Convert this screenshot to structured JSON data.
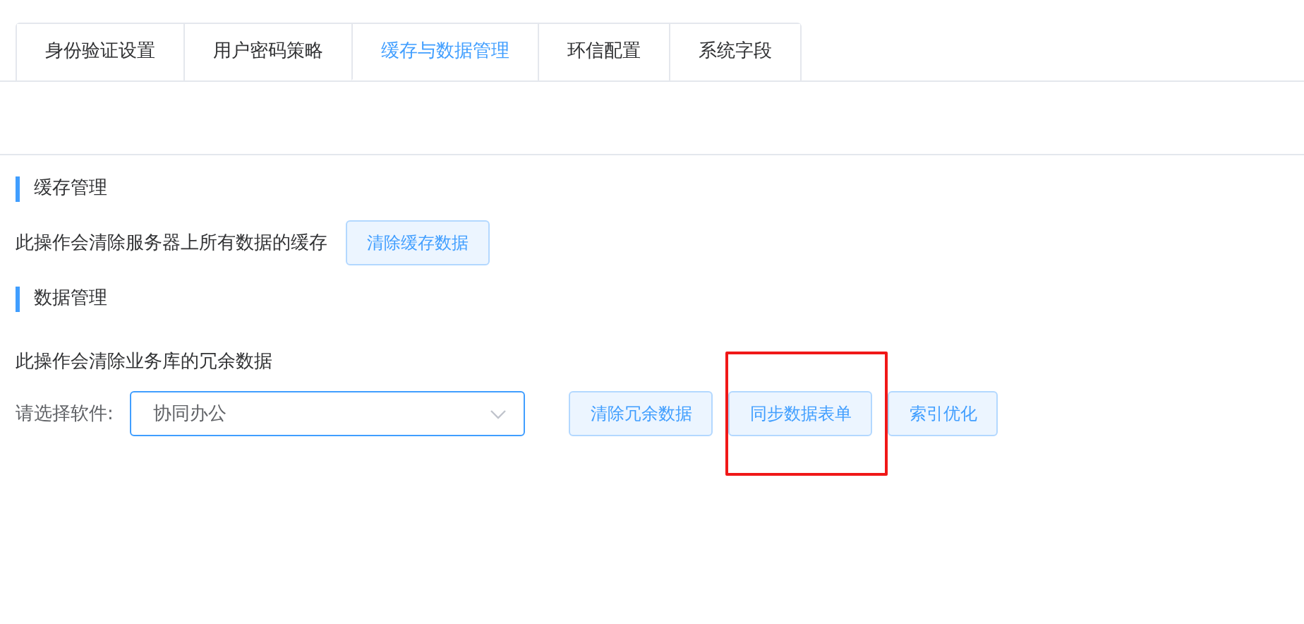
{
  "tabs": [
    {
      "label": "身份验证设置",
      "selected": false
    },
    {
      "label": "用户密码策略",
      "selected": false
    },
    {
      "label": "缓存与数据管理",
      "selected": true
    },
    {
      "label": "环信配置",
      "selected": false
    },
    {
      "label": "系统字段",
      "selected": false
    }
  ],
  "cache_section": {
    "title": "缓存管理",
    "description": "此操作会清除服务器上所有数据的缓存",
    "button": "清除缓存数据"
  },
  "data_section": {
    "title": "数据管理",
    "description": "此操作会清除业务库的冗余数据",
    "select_label": "请选择软件:",
    "select_value": "协同办公",
    "buttons": [
      {
        "label": "清除冗余数据",
        "highlighted": false
      },
      {
        "label": "同步数据表单",
        "highlighted": true
      },
      {
        "label": "索引优化",
        "highlighted": false
      }
    ]
  }
}
